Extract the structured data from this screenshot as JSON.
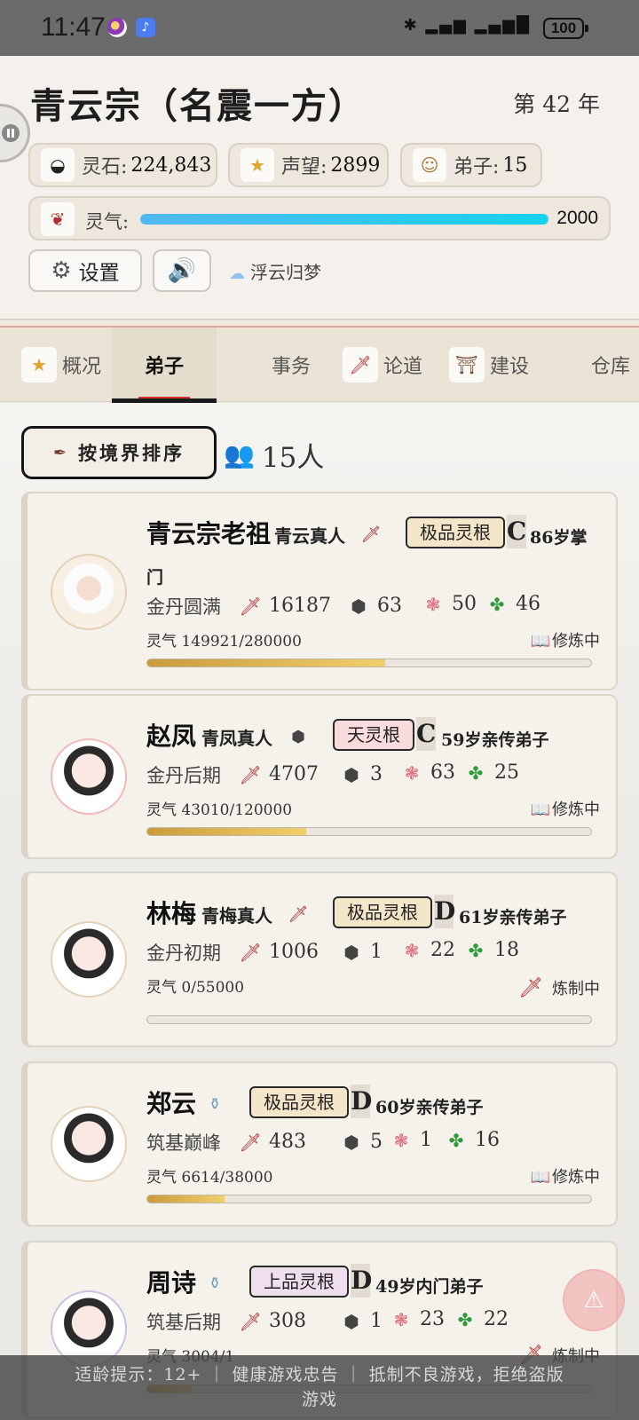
{
  "status_bar": {
    "time": "11:47",
    "battery": "100",
    "network": "4G 4G"
  },
  "header": {
    "sect_title": "青云宗（名震一方）",
    "year": "第 42 年",
    "resources": {
      "stone": {
        "label": "灵石:",
        "value": "224,843",
        "icon": "spirit-stone-icon"
      },
      "fame": {
        "label": "声望:",
        "value": "2899",
        "icon": "fame-star-icon"
      },
      "disciples": {
        "label": "弟子:",
        "value": "15",
        "icon": "disciple-icon"
      }
    },
    "qi": {
      "label": "灵气:",
      "value": "2000",
      "fill_percent": 100
    },
    "settings_label": "设置",
    "music_title": "浮云归梦"
  },
  "tabs": [
    {
      "label": "概况",
      "icon": "star-badge-icon"
    },
    {
      "label": "弟子",
      "active": true
    },
    {
      "label": "事务"
    },
    {
      "label": "论道",
      "icon": "sword-icon"
    },
    {
      "label": "建设",
      "icon": "pagoda-icon"
    },
    {
      "label": "仓库"
    }
  ],
  "toolbar": {
    "sort_label": "按境界排序",
    "count_text": "15人"
  },
  "disciples": [
    {
      "name": "青云宗老祖",
      "title": "青云真人",
      "root": "极品灵根",
      "grade": "C",
      "age": "86岁掌",
      "age_cont": "门",
      "realm": "金丹圆满",
      "atk": "16187",
      "def": "63",
      "wis": "50",
      "luck": "46",
      "qi": "灵气 149921/280000",
      "state": "修炼中",
      "progress": 0.535
    },
    {
      "name": "赵凤",
      "title": "青凤真人",
      "root": "天灵根",
      "grade": "C",
      "age": "59岁亲传弟子",
      "realm": "金丹后期",
      "atk": "4707",
      "def": "3",
      "wis": "63",
      "luck": "25",
      "qi": "灵气 43010/120000",
      "state": "修炼中",
      "progress": 0.358
    },
    {
      "name": "林梅",
      "title": "青梅真人",
      "root": "极品灵根",
      "grade": "D",
      "age": "61岁亲传弟子",
      "realm": "金丹初期",
      "atk": "1006",
      "def": "1",
      "wis": "22",
      "luck": "18",
      "qi": "灵气 0/55000",
      "state": "炼制中",
      "progress": 0
    },
    {
      "name": "郑云",
      "title": "",
      "root": "极品灵根",
      "grade": "D",
      "age": "60岁亲传弟子",
      "realm": "筑基巅峰",
      "atk": "483",
      "def": "5",
      "wis": "1",
      "luck": "16",
      "qi": "灵气 6614/38000",
      "state": "修炼中",
      "progress": 0.174
    },
    {
      "name": "周诗",
      "title": "",
      "root": "上品灵根",
      "grade": "D",
      "age": "49岁内门弟子",
      "realm": "筑基后期",
      "atk": "308",
      "def": "1",
      "wis": "23",
      "luck": "22",
      "qi": "灵气 3004/1",
      "state": "炼制中",
      "progress": 0.1
    }
  ],
  "notice": {
    "line1": "适龄提示：12+  ｜  健康游戏忠告  ｜  抵制不良游戏，拒绝盗版",
    "line2": "游戏"
  }
}
